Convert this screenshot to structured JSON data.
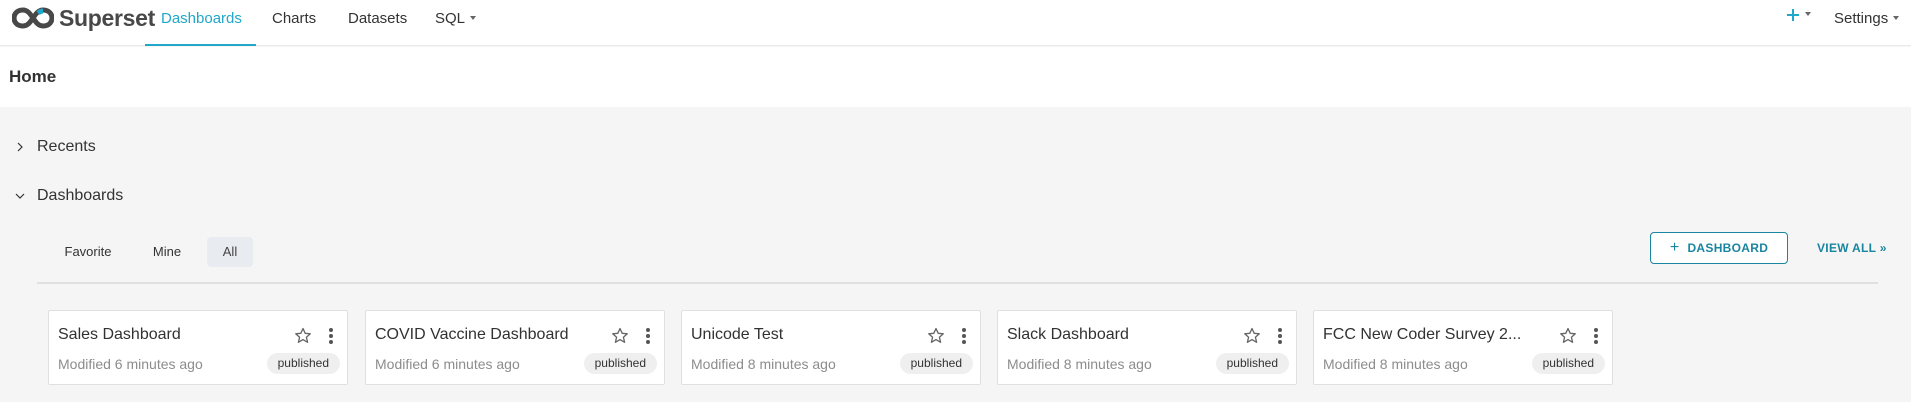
{
  "nav": {
    "brand": "Superset",
    "items": [
      {
        "label": "Dashboards",
        "active": true
      },
      {
        "label": "Charts"
      },
      {
        "label": "Datasets"
      },
      {
        "label": "SQL",
        "has_menu": true
      }
    ],
    "right": {
      "plus_icon": "plus-icon",
      "settings": "Settings"
    }
  },
  "page": {
    "title": "Home"
  },
  "sections": {
    "recents": "Recents",
    "dashboards": "Dashboards"
  },
  "filters": [
    {
      "label": "Favorite",
      "active": false
    },
    {
      "label": "Mine",
      "active": false
    },
    {
      "label": "All",
      "active": true
    }
  ],
  "actions": {
    "add_dashboard_icon": "+",
    "add_dashboard": "DASHBOARD",
    "view_all": "VIEW ALL »"
  },
  "cards": [
    {
      "title": "Sales Dashboard",
      "modified": "Modified 6 minutes ago",
      "status": "published"
    },
    {
      "title": "COVID Vaccine Dashboard",
      "modified": "Modified 6 minutes ago",
      "status": "published"
    },
    {
      "title": "Unicode Test",
      "modified": "Modified 8 minutes ago",
      "status": "published"
    },
    {
      "title": "Slack Dashboard",
      "modified": "Modified 8 minutes ago",
      "status": "published"
    },
    {
      "title": "FCC New Coder Survey 2...",
      "modified": "Modified 8 minutes ago",
      "status": "published"
    }
  ],
  "colors": {
    "accent": "#20a7c9",
    "primary_dark": "#1a85a0",
    "background": "#f5f5f5"
  }
}
